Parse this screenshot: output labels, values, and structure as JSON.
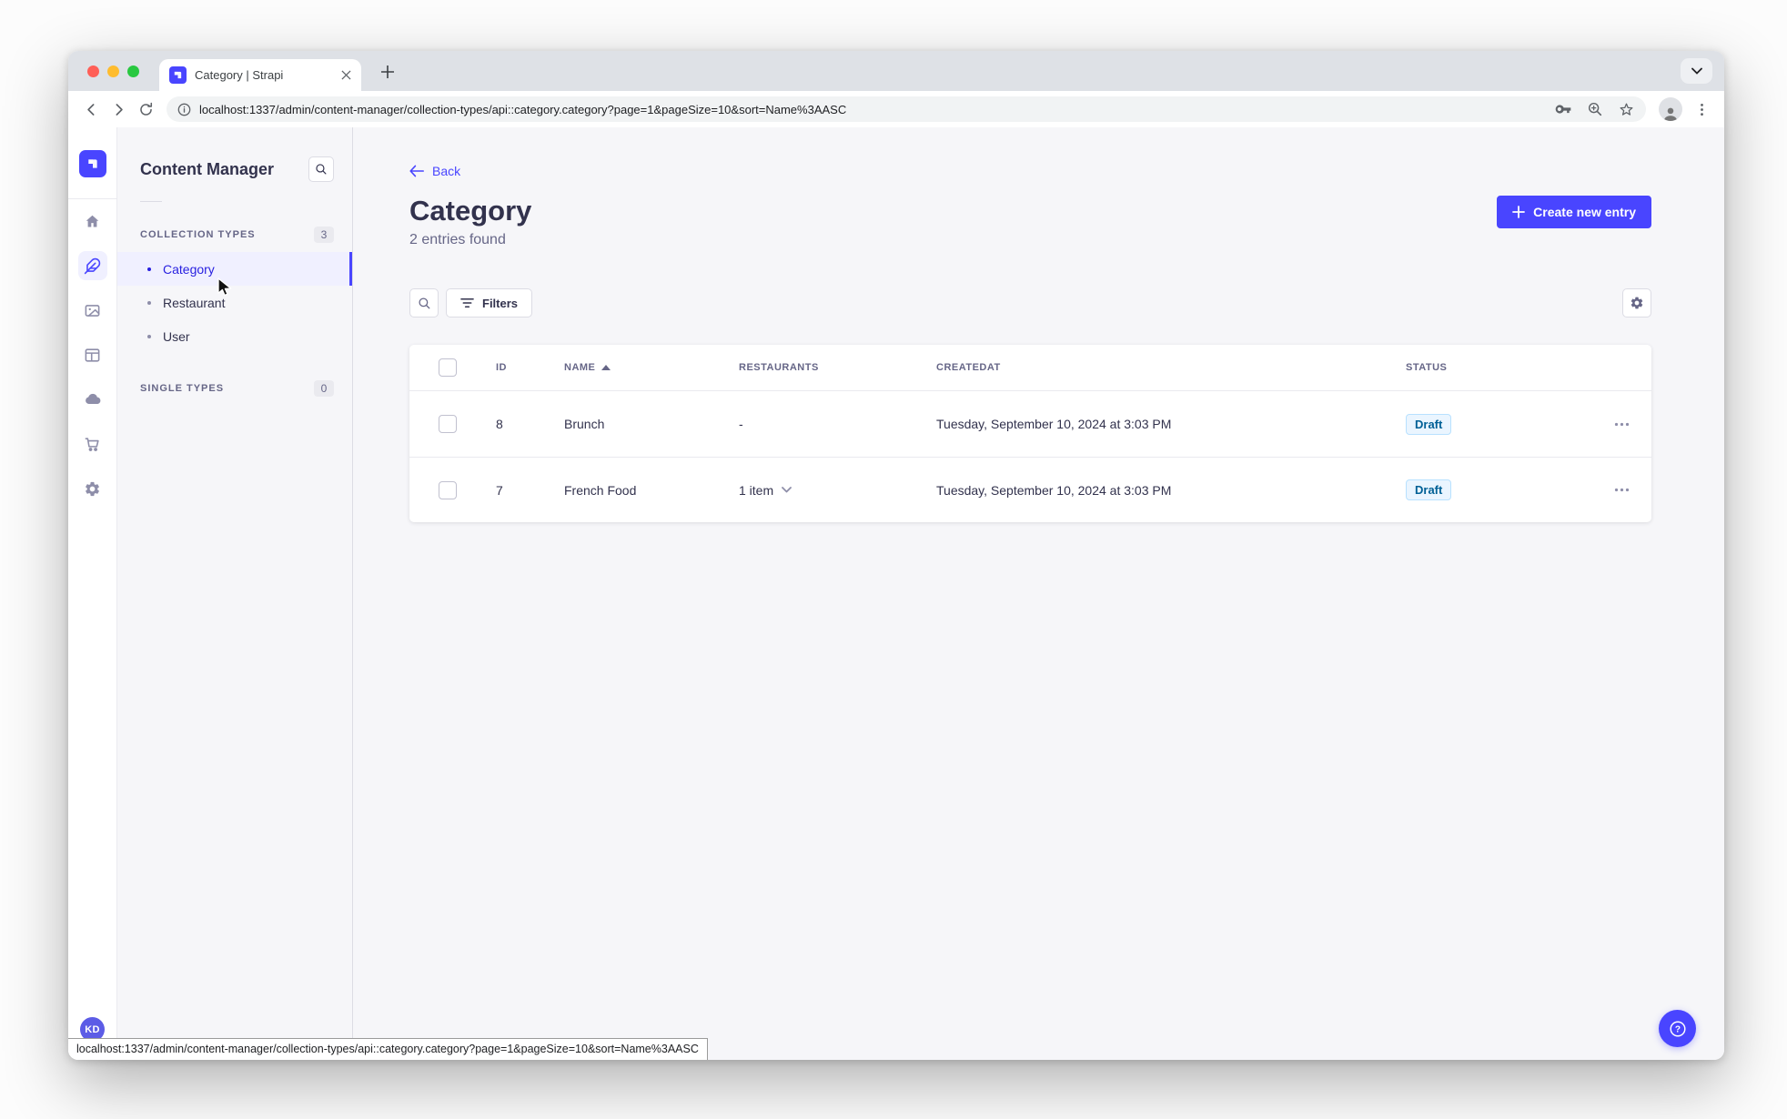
{
  "colors": {
    "accent": "#4945ff",
    "active_item_bg": "#f0f0ff",
    "active_item_text": "#271fe0",
    "draft_bg": "#eaf5ff",
    "draft_border": "#b8e1ff",
    "draft_text": "#006096",
    "text_dark": "#32324d",
    "text_gray": "#666687"
  },
  "browser": {
    "tab_title": "Category | Strapi",
    "url": "localhost:1337/admin/content-manager/collection-types/api::category.category?page=1&pageSize=10&sort=Name%3AASC",
    "status_bar_url": "localhost:1337/admin/content-manager/collection-types/api::category.category?page=1&pageSize=10&sort=Name%3AASC",
    "toolbar_icons": [
      "back-icon",
      "forward-icon",
      "reload-icon",
      "info-icon",
      "password-key-icon",
      "zoom-in-icon",
      "bookmark-star-icon",
      "profile-avatar-icon",
      "menu-dots-icon"
    ]
  },
  "rail": {
    "icons": [
      "home-icon",
      "content-manager-feather-icon",
      "media-library-icon",
      "content-type-builder-icon",
      "cloud-icon",
      "marketplace-cart-icon",
      "settings-gear-icon"
    ],
    "active_icon": "content-manager-feather-icon",
    "user_initials": "KD"
  },
  "subnav": {
    "title": "Content Manager",
    "collection_section": {
      "label": "COLLECTION TYPES",
      "count": "3",
      "items": [
        {
          "label": "Category",
          "active": true
        },
        {
          "label": "Restaurant",
          "active": false
        },
        {
          "label": "User",
          "active": false
        }
      ]
    },
    "single_section": {
      "label": "SINGLE TYPES",
      "count": "0"
    }
  },
  "main": {
    "back_label": "Back",
    "title": "Category",
    "subtitle": "2 entries found",
    "create_button_label": "Create new entry",
    "filters_button_label": "Filters",
    "table": {
      "columns": [
        "ID",
        "NAME",
        "RESTAURANTS",
        "CREATEDAT",
        "STATUS"
      ],
      "sorted_column": "NAME",
      "sort_direction": "ASC",
      "rows": [
        {
          "id": "8",
          "name": "Brunch",
          "restaurants": "-",
          "created_at": "Tuesday, September 10, 2024 at 3:03 PM",
          "status": "Draft"
        },
        {
          "id": "7",
          "name": "French Food",
          "restaurants": "1 item",
          "created_at": "Tuesday, September 10, 2024 at 3:03 PM",
          "status": "Draft"
        }
      ]
    }
  }
}
